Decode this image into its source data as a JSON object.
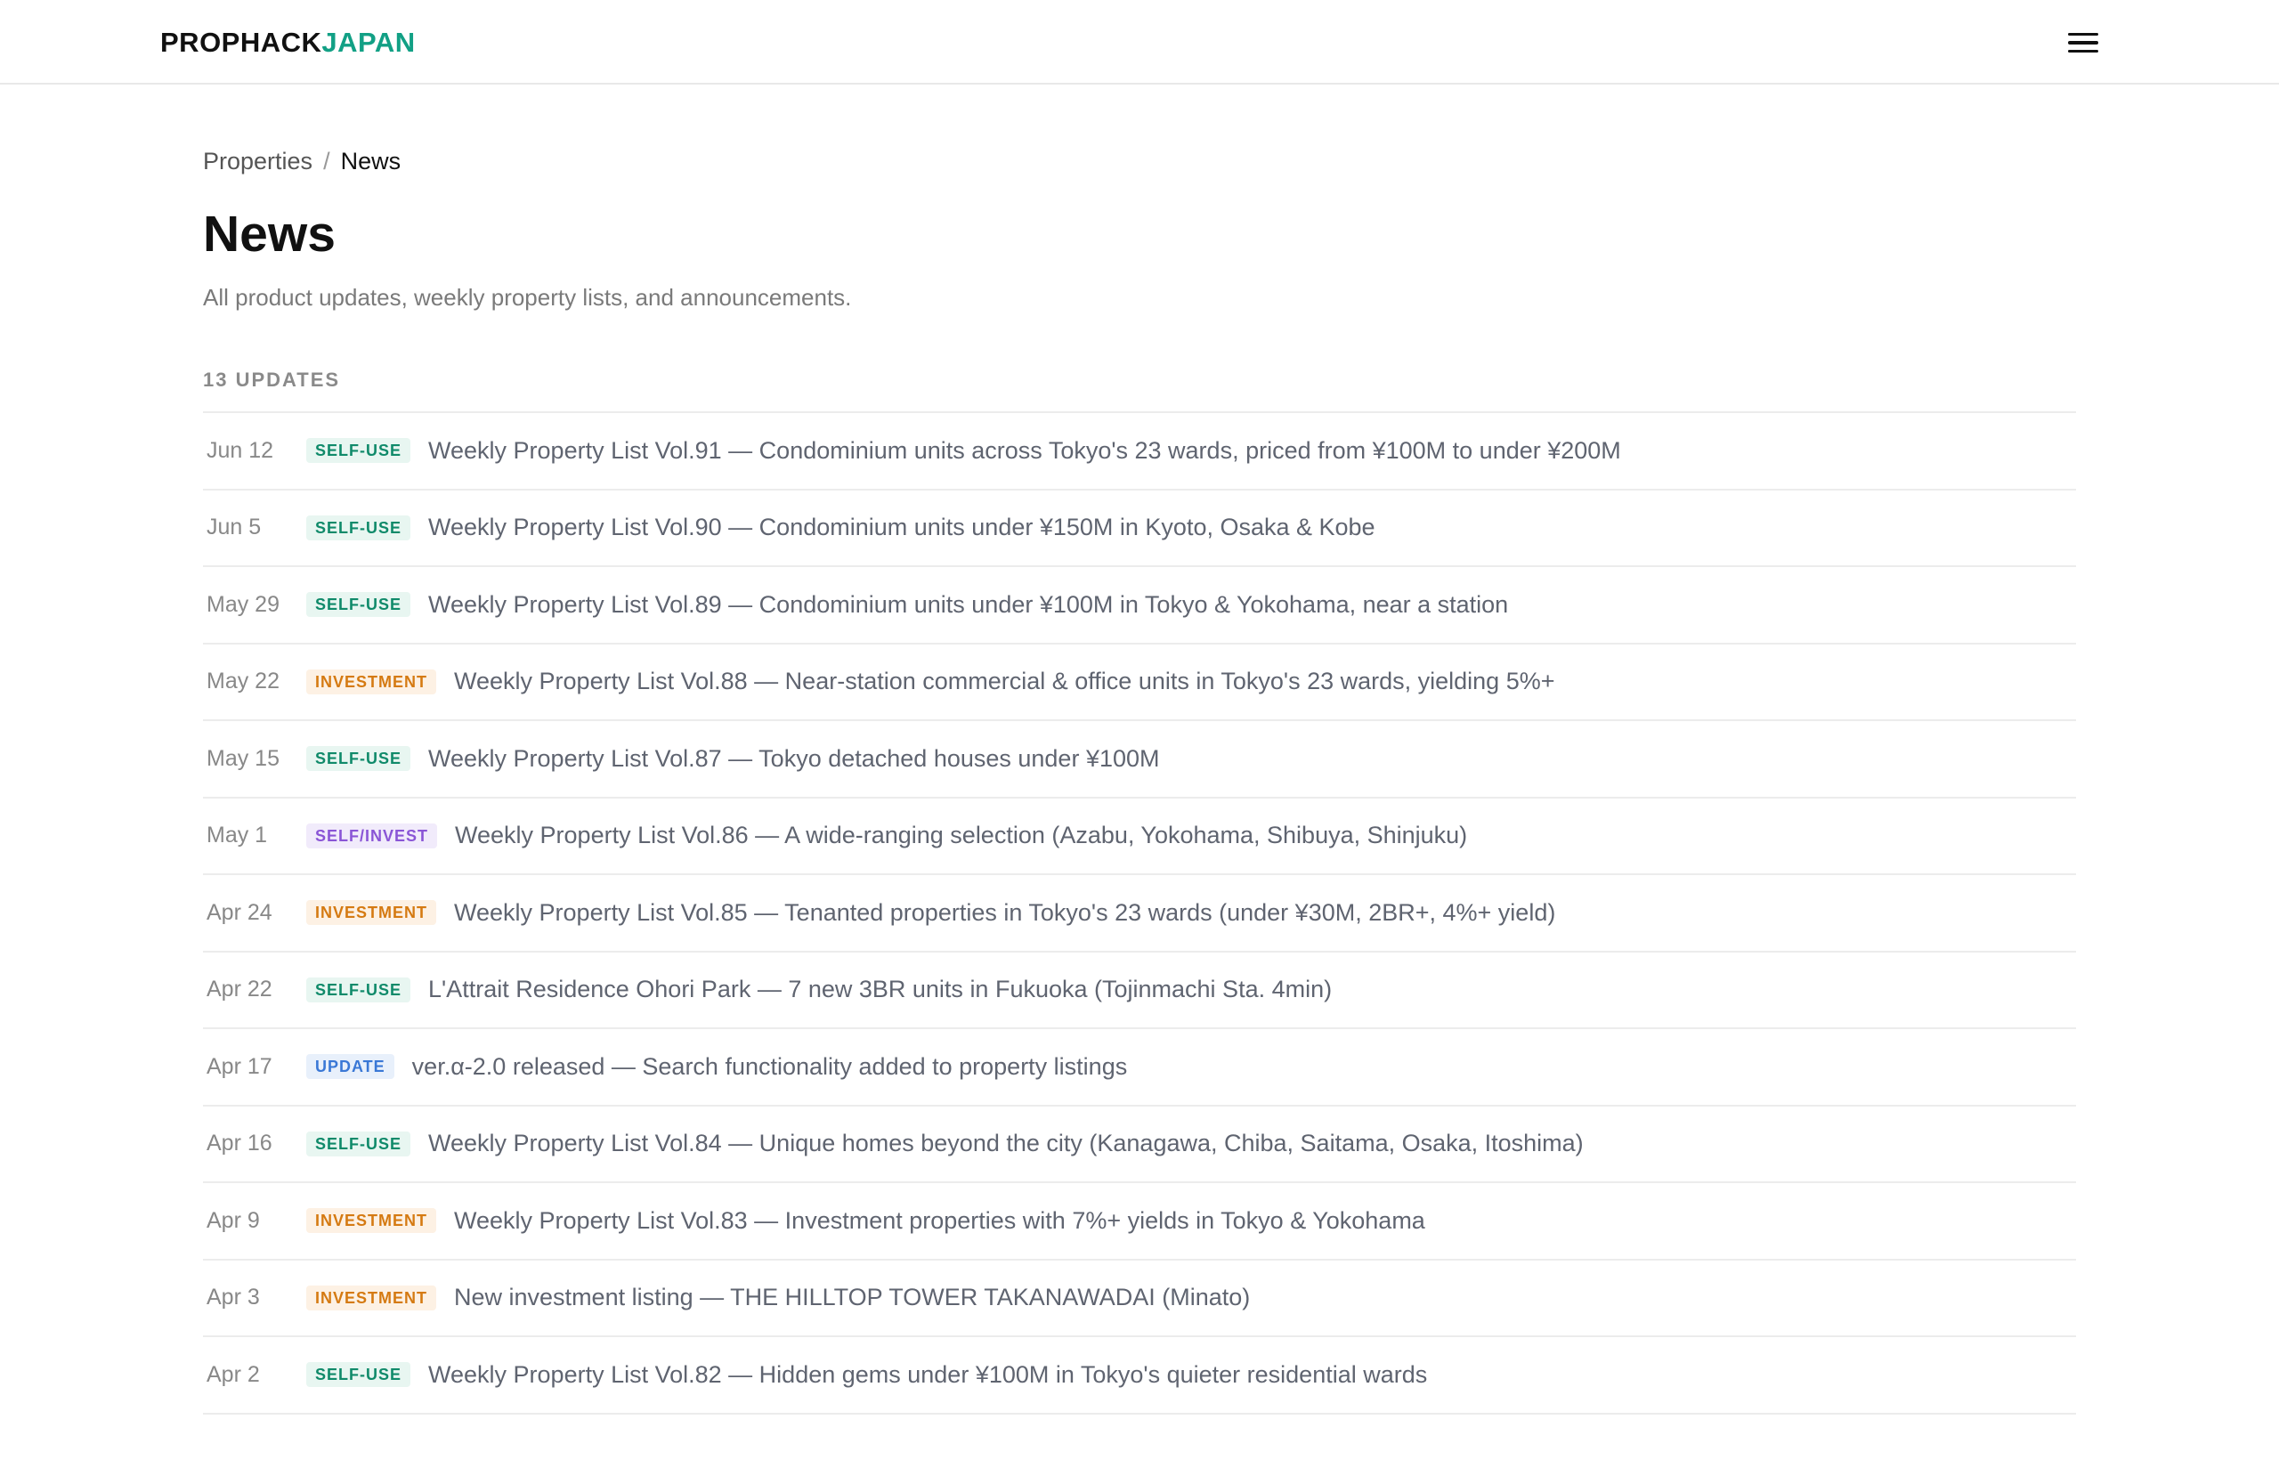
{
  "header": {
    "logo_part1": "PROPHACK",
    "logo_part2": "JAPAN",
    "menu_icon": "hamburger-menu-icon"
  },
  "breadcrumb": {
    "parent": "Properties",
    "separator": "/",
    "current": "News"
  },
  "page": {
    "title": "News",
    "subtitle": "All product updates, weekly property lists, and announcements.",
    "count_label": "13 UPDATES"
  },
  "colors": {
    "brand_accent": "#12a085",
    "self_use": "#108a6a",
    "investment": "#d57a12",
    "self_invest": "#8a55d6",
    "update": "#3a78d6"
  },
  "news": [
    {
      "date": "Jun 12",
      "tag": "SELF-USE",
      "tag_class": "self-use",
      "title": "Weekly Property List Vol.91 — Condominium units across Tokyo's 23 wards, priced from ¥100M to under ¥200M"
    },
    {
      "date": "Jun 5",
      "tag": "SELF-USE",
      "tag_class": "self-use",
      "title": "Weekly Property List Vol.90 — Condominium units under ¥150M in Kyoto, Osaka & Kobe"
    },
    {
      "date": "May 29",
      "tag": "SELF-USE",
      "tag_class": "self-use",
      "title": "Weekly Property List Vol.89 — Condominium units under ¥100M in Tokyo & Yokohama, near a station"
    },
    {
      "date": "May 22",
      "tag": "INVESTMENT",
      "tag_class": "investment",
      "title": "Weekly Property List Vol.88 — Near-station commercial & office units in Tokyo's 23 wards, yielding 5%+"
    },
    {
      "date": "May 15",
      "tag": "SELF-USE",
      "tag_class": "self-use",
      "title": "Weekly Property List Vol.87 — Tokyo detached houses under ¥100M"
    },
    {
      "date": "May 1",
      "tag": "SELF/INVEST",
      "tag_class": "self-invest",
      "title": "Weekly Property List Vol.86 — A wide-ranging selection (Azabu, Yokohama, Shibuya, Shinjuku)"
    },
    {
      "date": "Apr 24",
      "tag": "INVESTMENT",
      "tag_class": "investment",
      "title": "Weekly Property List Vol.85 — Tenanted properties in Tokyo's 23 wards (under ¥30M, 2BR+, 4%+ yield)"
    },
    {
      "date": "Apr 22",
      "tag": "SELF-USE",
      "tag_class": "self-use",
      "title": "L'Attrait Residence Ohori Park — 7 new 3BR units in Fukuoka (Tojinmachi Sta. 4min)"
    },
    {
      "date": "Apr 17",
      "tag": "UPDATE",
      "tag_class": "update",
      "title": "ver.α-2.0 released — Search functionality added to property listings"
    },
    {
      "date": "Apr 16",
      "tag": "SELF-USE",
      "tag_class": "self-use",
      "title": "Weekly Property List Vol.84 — Unique homes beyond the city (Kanagawa, Chiba, Saitama, Osaka, Itoshima)"
    },
    {
      "date": "Apr 9",
      "tag": "INVESTMENT",
      "tag_class": "investment",
      "title": "Weekly Property List Vol.83 — Investment properties with 7%+ yields in Tokyo & Yokohama"
    },
    {
      "date": "Apr 3",
      "tag": "INVESTMENT",
      "tag_class": "investment",
      "title": "New investment listing — THE HILLTOP TOWER TAKANAWADAI (Minato)"
    },
    {
      "date": "Apr 2",
      "tag": "SELF-USE",
      "tag_class": "self-use",
      "title": "Weekly Property List Vol.82 — Hidden gems under ¥100M in Tokyo's quieter residential wards"
    }
  ]
}
